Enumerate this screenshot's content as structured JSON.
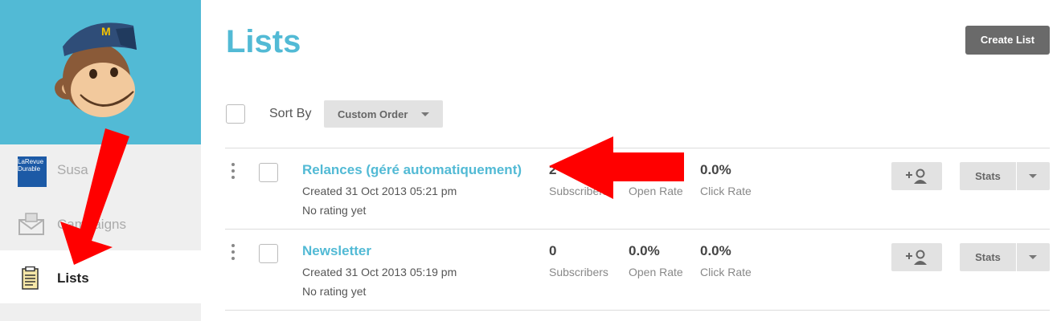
{
  "sidebar": {
    "user": {
      "logo_text": "LaRevue Durable",
      "label": "Susa"
    },
    "campaigns_label": "Campaigns",
    "lists_label": "Lists"
  },
  "header": {
    "title": "Lists",
    "create_button": "Create List"
  },
  "toolbar": {
    "sort_label": "Sort By",
    "sort_value": "Custom Order"
  },
  "lists": [
    {
      "name": "Relances (géré automatiquement)",
      "created": "Created 31 Oct 2013 05:21 pm",
      "rating": "No rating yet",
      "subscribers": "2",
      "subscribers_label": "Subscribers",
      "open_rate": "0.0%",
      "open_rate_label": "Open Rate",
      "click_rate": "0.0%",
      "click_rate_label": "Click Rate",
      "stats_button": "Stats"
    },
    {
      "name": "Newsletter",
      "created": "Created 31 Oct 2013 05:19 pm",
      "rating": "No rating yet",
      "subscribers": "0",
      "subscribers_label": "Subscribers",
      "open_rate": "0.0%",
      "open_rate_label": "Open Rate",
      "click_rate": "0.0%",
      "click_rate_label": "Click Rate",
      "stats_button": "Stats"
    }
  ],
  "colors": {
    "brand": "#52bad5",
    "annotation_arrow": "#ff0000",
    "sidebar_bg": "#efefef"
  },
  "icons": [
    "freddie-mascot-logo",
    "envelope-icon",
    "document-list-icon",
    "add-subscriber-icon",
    "chevron-down-icon",
    "drag-handle-icon"
  ]
}
